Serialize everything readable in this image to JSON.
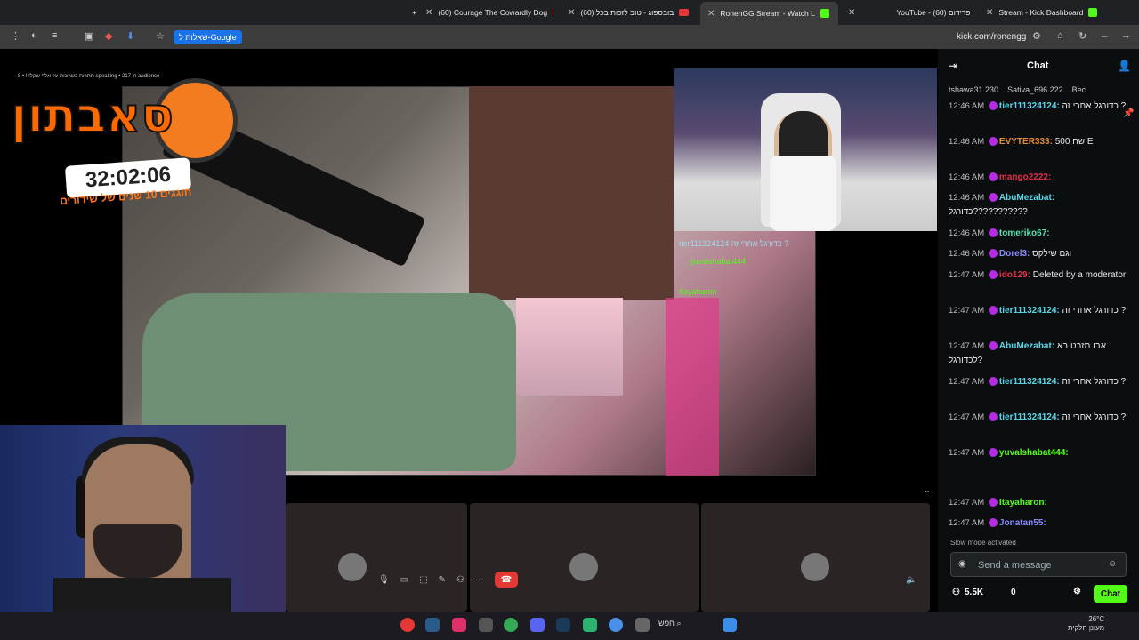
{
  "tabs": [
    {
      "title": "(60) Courage The Cowardly Dog",
      "icon": "youtube-icon"
    },
    {
      "title": "(60) בובספוג - טוב לזכות בכל",
      "icon": "youtube-icon"
    },
    {
      "title": "RonenGG Stream - Watch L",
      "icon": "kick-icon"
    },
    {
      "title": "YouTube - פרידום (60)",
      "icon": "youtube-icon"
    },
    {
      "title": "Stream - Kick Dashboard",
      "icon": "kick-icon"
    }
  ],
  "toolbar": {
    "google_pill": "שאלות ל-Google",
    "url": "kick.com/ronengg"
  },
  "stream": {
    "top_info": "תחרות כשרונות על אלף שקל!!! • 8 speaking • 217 in audience",
    "logo_text": "סאבתון",
    "timer": "32:02:06",
    "tagline": "חוגגים 10 שנים של שידורים",
    "overlay": {
      "line1": "tier111324124 כדורגל אחרי זה ?",
      "line2_user": "yuvalshabat444",
      "line3_user": "Itayaharon"
    }
  },
  "chat": {
    "title": "Chat",
    "gifters": [
      {
        "name": "tshawa31",
        "count": "230"
      },
      {
        "name": "Sativa_696",
        "count": "222"
      },
      {
        "name": "Bec",
        "count": ""
      }
    ],
    "messages": [
      {
        "time": "12:46 AM",
        "user": "tier111324124:",
        "color": "#58d6e8",
        "text": "כדורגל אחרי זה ?"
      },
      {
        "time": "12:46 AM",
        "user": "EVYTER333:",
        "color": "#e58a3a",
        "text": "500 שח E"
      },
      {
        "time": "12:46 AM",
        "user": "mango2222:",
        "color": "#e0304a",
        "text": ""
      },
      {
        "time": "12:46 AM",
        "user": "AbuMezabat:",
        "color": "#58d6e8",
        "text": "כדורגל???????????"
      },
      {
        "time": "12:46 AM",
        "user": "tomeriko67:",
        "color": "#58e0b0",
        "text": ""
      },
      {
        "time": "12:46 AM",
        "user": "Dorel3:",
        "color": "#8a8aff",
        "text": "וגם שילקס"
      },
      {
        "time": "12:47 AM",
        "user": "ido129:",
        "color": "#e0304a",
        "text": "Deleted by a moderator"
      },
      {
        "time": "12:47 AM",
        "user": "tier111324124:",
        "color": "#58d6e8",
        "text": "כדורגל אחרי זה ?"
      },
      {
        "time": "12:47 AM",
        "user": "AbuMezabat:",
        "color": "#58d6e8",
        "text": "אבו מזבט בא לכדורגל?"
      },
      {
        "time": "12:47 AM",
        "user": "tier111324124:",
        "color": "#58d6e8",
        "text": "כדורגל אחרי זה ?"
      },
      {
        "time": "12:47 AM",
        "user": "tier111324124:",
        "color": "#58d6e8",
        "text": "כדורגל אחרי זה ?"
      },
      {
        "time": "12:47 AM",
        "user": "yuvalshabat444:",
        "color": "#53fc18",
        "text": ""
      },
      {
        "time": "12:47 AM",
        "user": "Itayaharon:",
        "color": "#53fc18",
        "text": ""
      },
      {
        "time": "12:47 AM",
        "user": "Jonatan55:",
        "color": "#8a8aff",
        "text": ""
      }
    ],
    "slow_mode": "Slow mode activated",
    "placeholder": "Send a message",
    "viewers": "5.5K",
    "points": "0",
    "chat_button": "Chat"
  },
  "taskbar": {
    "search": "חפש",
    "temp": "26°C",
    "weather": "מעונן חלקית"
  }
}
